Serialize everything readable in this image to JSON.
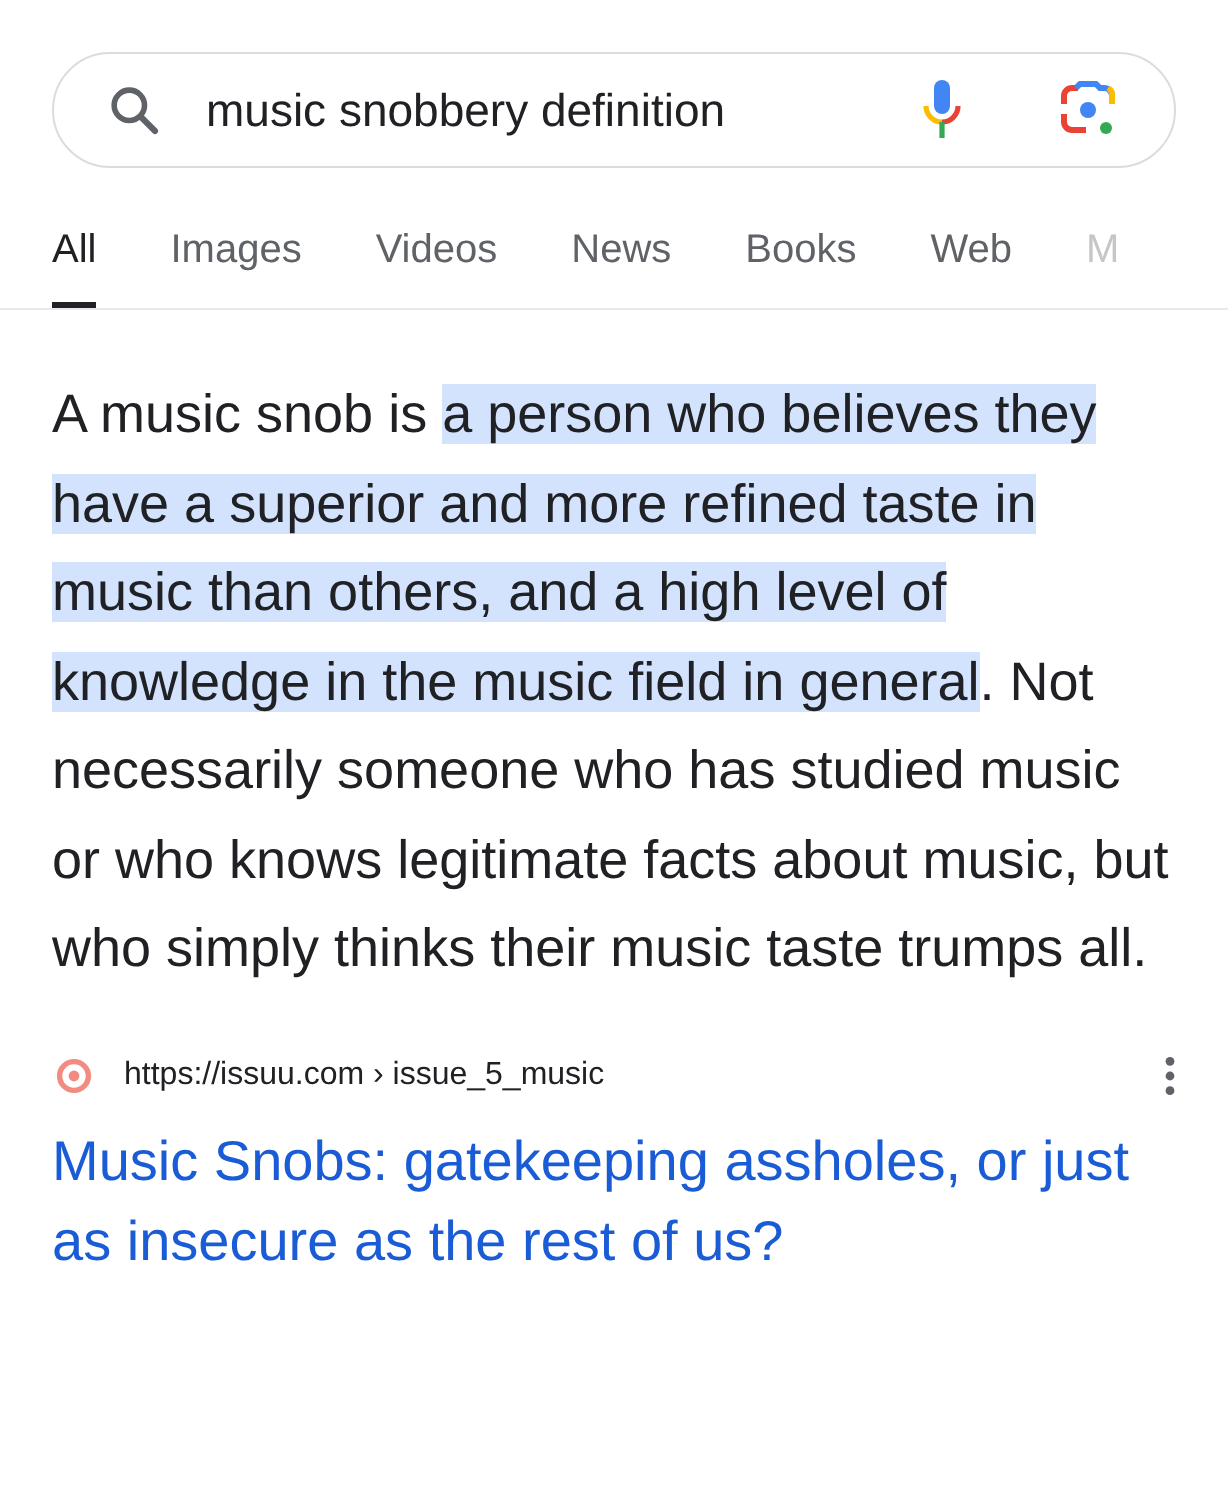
{
  "search": {
    "value": "music snobbery definition"
  },
  "tabs": [
    {
      "label": "All",
      "selected": true
    },
    {
      "label": "Images",
      "selected": false
    },
    {
      "label": "Videos",
      "selected": false
    },
    {
      "label": "News",
      "selected": false
    },
    {
      "label": "Books",
      "selected": false
    },
    {
      "label": "Web",
      "selected": false
    },
    {
      "label": "M",
      "selected": false
    }
  ],
  "snippet": [
    {
      "text": "A music snob is ",
      "highlighted": false
    },
    {
      "text": "a person who believes they have a superior and more refined taste in music than others, and a high level of knowledge in the music field in general",
      "highlighted": true
    },
    {
      "text": ". Not necessarily someone who has studied music or who knows legitimate facts about music, but who simply thinks their music taste trumps all.",
      "highlighted": false
    }
  ],
  "result": {
    "url": "https://issuu.com › issue_5_music",
    "title": "Music Snobs: gatekeeping assholes, or just as insecure as the rest of us?"
  }
}
